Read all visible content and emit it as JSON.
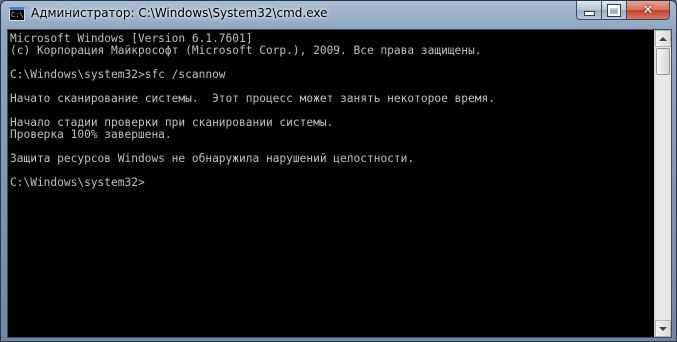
{
  "window": {
    "title": "Администратор: C:\\Windows\\System32\\cmd.exe",
    "icon": "cmd-icon"
  },
  "caption_buttons": {
    "minimize_icon": "minimize-icon",
    "maximize_icon": "maximize-icon",
    "close_glyph": "✕"
  },
  "console": {
    "lines": [
      "Microsoft Windows [Version 6.1.7601]",
      "(c) Корпорация Майкрософт (Microsoft Corp.), 2009. Все права защищены.",
      "",
      "C:\\Windows\\system32>sfc /scannow",
      "",
      "Начато сканирование системы.  Этот процесс может занять некоторое время.",
      "",
      "Начало стадии проверки при сканировании системы.",
      "Проверка 100% завершена.",
      "",
      "Защита ресурсов Windows не обнаружила нарушений целостности.",
      "",
      "C:\\Windows\\system32>"
    ],
    "text_color": "#c0c0c0",
    "background": "#000000"
  },
  "scrollbar": {
    "up_icon": "scroll-up-arrow-icon",
    "down_icon": "scroll-down-arrow-icon"
  }
}
